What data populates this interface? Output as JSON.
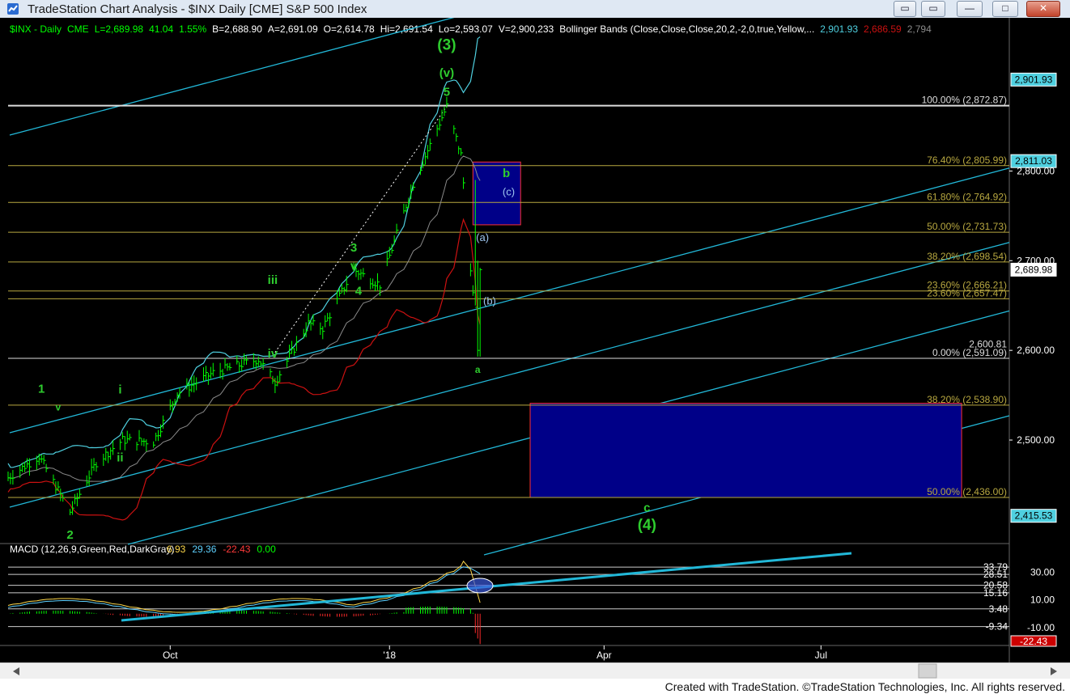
{
  "window": {
    "title": "TradeStation Chart Analysis - $INX Daily [CME] S&P 500 Index",
    "buttons": [
      "minimize",
      "maximize",
      "close"
    ]
  },
  "footer": {
    "credit": "Created with TradeStation. ©TradeStation Technologies, Inc. All rights reserved."
  },
  "colors": {
    "background": "#000000",
    "price_bars": "#00ff00",
    "upper_band": "#4fd0e0",
    "lower_band": "#cc1111",
    "mid_band": "#8a8a8a",
    "channel": "#22b8d8",
    "fib": "#b8a840",
    "wave_label": "#2ecc2e",
    "sub_wave": "#9ec6f0",
    "target_box": "#000088",
    "box_border": "#ff3030"
  },
  "chart_data": [
    {
      "type": "ohlc",
      "header": {
        "symbol": "$INX - Daily",
        "exchange": "CME",
        "last": "L=2,689.98",
        "change": "41.04",
        "change_pct": "1.55%",
        "bid": "B=2,688.90",
        "ask": "A=2,691.09",
        "open": "O=2,614.78",
        "high": "Hi=2,691.54",
        "low": "Lo=2,593.07",
        "volume": "V=2,900,233",
        "indicator": "Bollinger Bands (Close,Close,Close,20,2,-2,0,true,Yellow,...",
        "indicator_values": [
          "2,901.93",
          "2,686.59",
          "2,794"
        ]
      },
      "price_axis": {
        "ticks": [
          "2,800.00",
          "2,700.00",
          "2,600.00",
          "2,500.00"
        ],
        "ylim": [
          2390,
          2960
        ]
      },
      "time_axis": {
        "labels": [
          "Oct",
          "'18",
          "Apr",
          "Jul"
        ],
        "label_dates": [
          "2017-10-02",
          "2018-01-02",
          "2018-04-02",
          "2018-07-02"
        ],
        "xlim": [
          "2017-07-26",
          "2018-09-19"
        ]
      },
      "value_tags": [
        {
          "text": "2,901.93",
          "value": 2901.93,
          "style": "band"
        },
        {
          "text": "2,811.03",
          "value": 2811.03,
          "style": "band"
        },
        {
          "text": "2,689.98",
          "value": 2689.98,
          "style": "last"
        },
        {
          "text": "2,415.53",
          "value": 2415.53,
          "style": "band"
        }
      ],
      "fib_levels": [
        {
          "label": "100.00%",
          "price_text": "(2,872.87)",
          "value": 2872.87
        },
        {
          "label": "76.40%",
          "price_text": "(2,805.99)",
          "value": 2805.99
        },
        {
          "label": "61.80%",
          "price_text": "(2,764.92)",
          "value": 2764.92
        },
        {
          "label": "50.00%",
          "price_text": "(2,731.73)",
          "value": 2731.73
        },
        {
          "label": "38.20%",
          "price_text": "(2,698.54)",
          "value": 2698.54
        },
        {
          "label": "23.60%",
          "price_text": "(2,666.21)",
          "value": 2666.21
        },
        {
          "label": "23.60%",
          "price_text": "(2,657.47)",
          "value": 2657.47
        },
        {
          "label": "0.00%",
          "price_text": "(2,591.09)",
          "value": 2591.09
        },
        {
          "label": "38.20%",
          "price_text": "(2,538.90)",
          "value": 2538.9
        },
        {
          "label": "50.00%",
          "price_text": "(2,436.00)",
          "value": 2436.0
        }
      ],
      "extra_price_labels": [
        {
          "text": "2,600.81",
          "value": 2600.81
        }
      ],
      "target_zones": [
        {
          "date_from": "2018-02-06",
          "date_to": "2018-02-26",
          "from": 2740,
          "to": 2810
        },
        {
          "date_from": "2018-03-02",
          "date_to": "2018-08-30",
          "from": 2436,
          "to": 2541
        }
      ],
      "wave_labels": [
        {
          "text": "(3)",
          "date": "2018-01-26",
          "value": 2935,
          "size": "large"
        },
        {
          "text": "(v)",
          "date": "2018-01-26",
          "value": 2905,
          "size": "medium"
        },
        {
          "text": "5",
          "date": "2018-01-26",
          "value": 2884,
          "size": "medium"
        },
        {
          "text": "3",
          "date": "2017-12-18",
          "value": 2710,
          "size": "medium"
        },
        {
          "text": "v",
          "date": "2017-12-18",
          "value": 2690,
          "size": "medium"
        },
        {
          "text": "4",
          "date": "2017-12-20",
          "value": 2662,
          "size": "medium"
        },
        {
          "text": "iii",
          "date": "2017-11-14",
          "value": 2674,
          "size": "medium"
        },
        {
          "text": "iv",
          "date": "2017-11-14",
          "value": 2592,
          "size": "medium"
        },
        {
          "text": "i",
          "date": "2017-09-11",
          "value": 2552,
          "size": "medium"
        },
        {
          "text": "ii",
          "date": "2017-09-11",
          "value": 2476,
          "size": "medium"
        },
        {
          "text": "1",
          "date": "2017-08-09",
          "value": 2553,
          "size": "medium"
        },
        {
          "text": "v",
          "date": "2017-08-16",
          "value": 2533,
          "size": "small"
        },
        {
          "text": "2",
          "date": "2017-08-21",
          "value": 2390,
          "size": "medium"
        },
        {
          "text": "a",
          "date": "2018-02-08",
          "value": 2575,
          "size": "small"
        },
        {
          "text": "b",
          "date": "2018-02-20",
          "value": 2793,
          "size": "medium"
        },
        {
          "text": "c",
          "date": "2018-04-20",
          "value": 2420,
          "size": "medium"
        },
        {
          "text": "(4)",
          "date": "2018-04-20",
          "value": 2400,
          "size": "large"
        }
      ],
      "sub_wave_labels": [
        {
          "text": "(c)",
          "date": "2018-02-21",
          "value": 2773
        },
        {
          "text": "(a)",
          "date": "2018-02-10",
          "value": 2722
        },
        {
          "text": "(b)",
          "date": "2018-02-13",
          "value": 2651
        }
      ]
    },
    {
      "type": "macd",
      "title": "MACD (12,26,9,Green,Red,DarkGray)",
      "values": {
        "macd": "6.93",
        "signal": "29.36",
        "diff": "-22.43",
        "zero": "0.00"
      },
      "ylim": [
        -22.43,
        45
      ],
      "axis_ticks": [
        "30.00",
        "10.00",
        "-10.00"
      ],
      "level_lines": [
        {
          "text": "33.79",
          "value": 33.79
        },
        {
          "text": "28.51",
          "value": 28.51
        },
        {
          "text": "20.58",
          "value": 20.58
        },
        {
          "text": "15.16",
          "value": 15.16
        },
        {
          "text": "3.48",
          "value": 3.48
        },
        {
          "text": "-9.34",
          "value": -9.34
        }
      ],
      "last_value_tag": "-22.43"
    }
  ]
}
